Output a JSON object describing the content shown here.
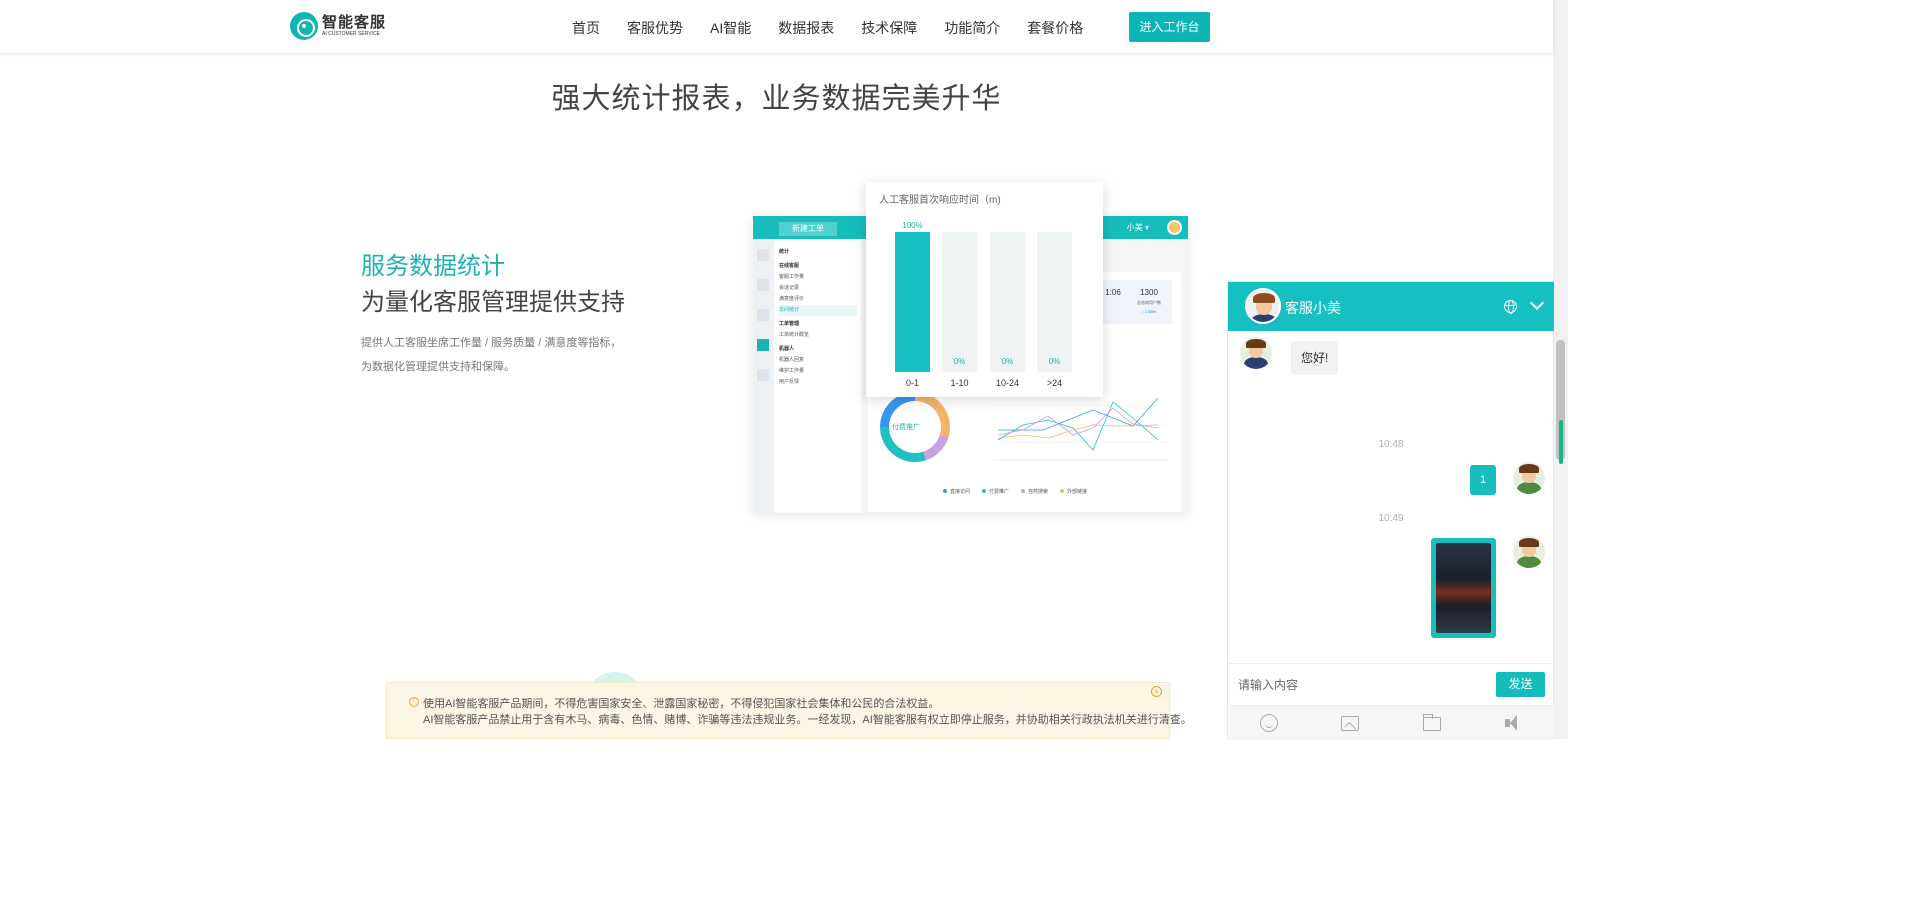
{
  "header": {
    "logo_cn": "智能客服",
    "logo_en": "AI CUSTOMER SERVICE",
    "nav": [
      "首页",
      "客服优势",
      "AI智能",
      "数据报表",
      "技术保障",
      "功能简介",
      "套餐价格"
    ],
    "cta_label": "进入工作台"
  },
  "section": {
    "title": "强大统计报表，业务数据完美升华",
    "feature_title": "服务数据统计",
    "feature_subtitle": "为量化客服管理提供支持",
    "feature_desc": "提供人工客服坐席工作量 / 服务质量 / 满意度等指标，为数据化管理提供支持和保障。"
  },
  "mockup": {
    "new_ticket_label": "新建工单",
    "user_name": "小美",
    "menu": [
      {
        "label": "统计",
        "type": "head"
      },
      {
        "label": "在线客服",
        "type": "head"
      },
      {
        "label": "客服工作量",
        "type": "item"
      },
      {
        "label": "会话记录",
        "type": "item"
      },
      {
        "label": "满意度评价",
        "type": "item"
      },
      {
        "label": "访问统计",
        "type": "selected"
      },
      {
        "label": "工单管理",
        "type": "head"
      },
      {
        "label": "工单统计概览",
        "type": "item"
      },
      {
        "label": "机器人",
        "type": "head"
      },
      {
        "label": "机器人回复",
        "type": "item"
      },
      {
        "label": "维护工作量",
        "type": "item"
      },
      {
        "label": "用户反馈",
        "type": "item"
      }
    ],
    "stat_a_value": "1:06",
    "stat_b_value": "1300",
    "stat_b_label": "总咨询用户数",
    "stat_b_delta": "↓ 1.55%",
    "donut_label": "付费推广",
    "legend": [
      "直接访问",
      "付费推广",
      "自然搜索",
      "外部链接"
    ]
  },
  "chart_data": {
    "type": "bar",
    "title": "人工客服首次响应时间（m)",
    "categories": [
      "0-1",
      "1-10",
      "10-24",
      ">24"
    ],
    "values": [
      100,
      0,
      0,
      0
    ],
    "value_labels": [
      "100%",
      "0%",
      "0%",
      "0%"
    ],
    "ylim": [
      0,
      100
    ]
  },
  "chat": {
    "agent_name": "客服小美",
    "messages": [
      {
        "from": "agent",
        "text": "您好!"
      },
      {
        "time": "10:48"
      },
      {
        "from": "user",
        "text": "1"
      },
      {
        "time": "10:49"
      },
      {
        "from": "user",
        "type": "image"
      }
    ],
    "input_placeholder": "请输入内容",
    "send_label": "发送",
    "tools": [
      "smile-icon",
      "image-icon",
      "folder-icon",
      "volume-icon"
    ]
  },
  "notice": {
    "line1": "使用AI智能客服产品期间，不得危害国家安全、泄露国家秘密，不得侵犯国家社会集体和公民的合法权益。",
    "line2": "AI智能客服产品禁止用于含有木马、病毒、色情、赌博、诈骗等违法违规业务。一经发现，AI智能客服有权立即停止服务，并协助相关行政执法机关进行清查。"
  },
  "colors": {
    "accent": "#16c0c0",
    "feature_title": "#1eb2b2",
    "notice_bg": "#fbf5e4",
    "warning": "#e6a23c"
  }
}
